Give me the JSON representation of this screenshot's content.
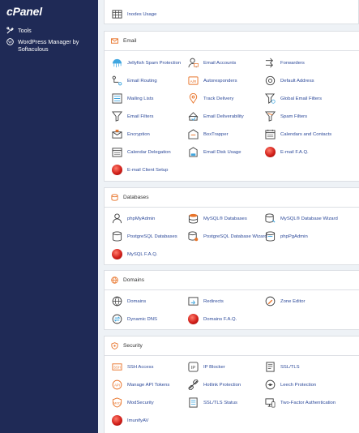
{
  "sidebar": {
    "logo": "cPanel",
    "items": [
      {
        "label": "Tools",
        "icon": "tools-icon"
      },
      {
        "label": "WordPress Manager by Softaculous",
        "line1": "WordPress Manager by",
        "line2": "Softaculous",
        "icon": "wordpress-icon"
      }
    ]
  },
  "top_partial": {
    "label": "Inodes Usage"
  },
  "sections": {
    "email": {
      "title": "Email",
      "items": [
        "Jellyfish Spam Protection",
        "Email Accounts",
        "Forwarders",
        "Email Routing",
        "Autoresponders",
        "Default Address",
        "Mailing Lists",
        "Track Delivery",
        "Global Email Filters",
        "Email Filters",
        "Email Deliverability",
        "Spam Filters",
        "Encryption",
        "BoxTrapper",
        "Calendars and Contacts",
        "Calendar Delegation",
        "Email Disk Usage",
        "E-mail F.A.Q.",
        "E-mail Client Setup"
      ]
    },
    "databases": {
      "title": "Databases",
      "items": [
        "phpMyAdmin",
        "MySQL® Databases",
        "MySQL® Database Wizard",
        "PostgreSQL Databases",
        "PostgreSQL Database Wizard",
        "phpPgAdmin",
        "MySQL F.A.Q."
      ]
    },
    "domains": {
      "title": "Domains",
      "items": [
        "Domains",
        "Redirects",
        "Zone Editor",
        "Dynamic DNS",
        "Domains F.A.Q."
      ]
    },
    "security": {
      "title": "Security",
      "items": [
        "SSH Access",
        "IP Blocker",
        "SSL/TLS",
        "Manage API Tokens",
        "Hotlink Protection",
        "Leech Protection",
        "ModSecurity",
        "SSL/TLS Status",
        "Two-Factor Authentication",
        "ImunifyAV"
      ]
    }
  },
  "colors": {
    "sidebar": "#1f2a56",
    "link": "#2d4a9a",
    "accent_orange": "#e8742a",
    "faq_red": "#d2201a"
  }
}
